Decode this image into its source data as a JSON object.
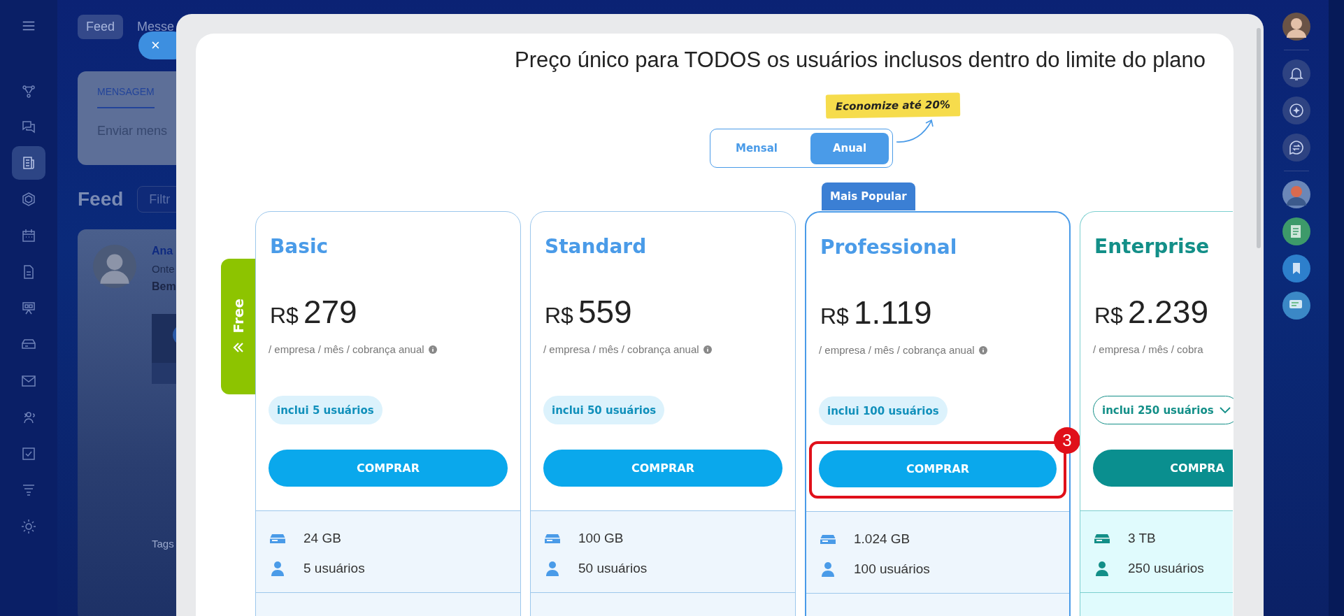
{
  "top_tabs": [
    {
      "label": "Feed",
      "selected": true
    },
    {
      "label": "Messe",
      "selected": false
    }
  ],
  "left_nav": [
    {
      "kind": "flow",
      "selected": false
    },
    {
      "kind": "chat",
      "selected": false
    },
    {
      "kind": "news",
      "selected": true
    },
    {
      "kind": "hexagon",
      "selected": false
    },
    {
      "kind": "calendar",
      "selected": false
    },
    {
      "kind": "document",
      "selected": false
    },
    {
      "kind": "board",
      "selected": false
    },
    {
      "kind": "drive",
      "selected": false
    },
    {
      "kind": "mail",
      "selected": false
    },
    {
      "kind": "people",
      "selected": false
    },
    {
      "kind": "task",
      "selected": false
    },
    {
      "kind": "filter",
      "selected": false
    },
    {
      "kind": "settings",
      "selected": false
    }
  ],
  "composer": {
    "tab": "MENSAGEM",
    "placeholder": "Enviar mens"
  },
  "feed": {
    "title": "Feed",
    "filter_placeholder": "Filtr"
  },
  "post": {
    "author": "Ana",
    "time": "Onte",
    "text": "Bem",
    "tags_label": "Tags"
  },
  "close_button": "×",
  "modal": {
    "heading": "Preço único para TODOS os usuários inclusos dentro do limite do plano",
    "promo_badge": "Economize até 20%",
    "billing_options": [
      {
        "label": "Mensal",
        "selected": false
      },
      {
        "label": "Anual",
        "selected": true
      }
    ],
    "free_tab": "Free",
    "plans": [
      {
        "kind": "standard",
        "name": "Basic",
        "popular": false,
        "currency": "R$",
        "price": "279",
        "period": "/ empresa / mês / cobrança anual",
        "info_icon": true,
        "users_pill": "inclui 5 usuários",
        "dropdown": false,
        "button": "COMPRAR",
        "features": [
          {
            "kind": "storage",
            "text": "24 GB"
          },
          {
            "kind": "users",
            "text": "5 usuários"
          }
        ]
      },
      {
        "kind": "standard",
        "name": "Standard",
        "popular": false,
        "currency": "R$",
        "price": "559",
        "period": "/ empresa / mês / cobrança anual",
        "info_icon": true,
        "users_pill": "inclui 50 usuários",
        "dropdown": false,
        "button": "COMPRAR",
        "features": [
          {
            "kind": "storage",
            "text": "100 GB"
          },
          {
            "kind": "users",
            "text": "50 usuários"
          }
        ]
      },
      {
        "kind": "standard",
        "name": "Professional",
        "popular": true,
        "popular_label": "Mais Popular",
        "callout": "3",
        "currency": "R$",
        "price": "1.119",
        "period": "/ empresa / mês / cobrança anual",
        "info_icon": true,
        "users_pill": "inclui 100 usuários",
        "dropdown": false,
        "button": "COMPRAR",
        "features": [
          {
            "kind": "storage",
            "text": "1.024 GB"
          },
          {
            "kind": "users",
            "text": "100 usuários"
          }
        ]
      },
      {
        "kind": "enterprise",
        "name": "Enterprise",
        "popular": false,
        "currency": "R$",
        "price": "2.239",
        "period": "/ empresa / mês / cobra",
        "info_icon": false,
        "users_pill": "inclui 250 usuários",
        "dropdown": true,
        "button": "COMPRA",
        "features": [
          {
            "kind": "storage",
            "text": "3 TB"
          },
          {
            "kind": "users",
            "text": "250 usuários"
          }
        ]
      }
    ]
  }
}
